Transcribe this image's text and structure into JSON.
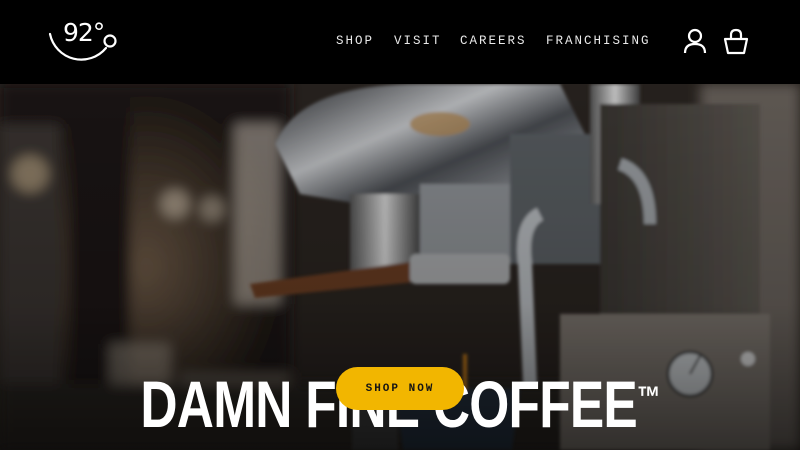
{
  "brand": {
    "logo_text": "92°"
  },
  "nav": {
    "items": [
      {
        "label": "SHOP"
      },
      {
        "label": "VISIT"
      },
      {
        "label": "CAREERS"
      },
      {
        "label": "FRANCHISING"
      }
    ]
  },
  "header_icons": {
    "account": "user-icon",
    "cart": "shopping-bag-icon"
  },
  "hero": {
    "title": "DAMN FINE COFFEE",
    "trademark": "™",
    "cta_label": "SHOP NOW"
  },
  "colors": {
    "header_bg": "#000000",
    "cta_bg": "#f2b600",
    "cta_text": "#141414",
    "nav_text": "#e9e9e9"
  }
}
